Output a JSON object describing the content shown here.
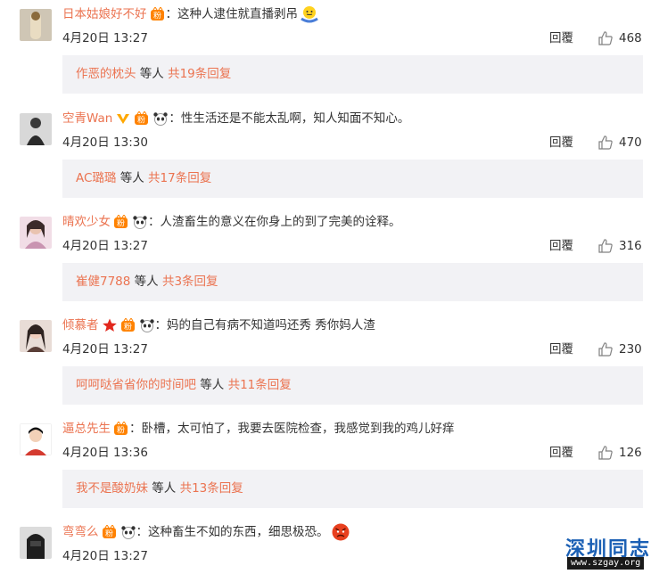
{
  "comments": [
    {
      "user": "日本姑娘好不好",
      "text": "：这种人逮住就直播剥吊",
      "time": "4月20日 13:27",
      "reply": "回覆",
      "likes": "468",
      "replies": {
        "name": "作恶的枕头",
        "mid": " 等人 ",
        "count": "共19条回复"
      }
    },
    {
      "user": "空青Wan",
      "text": "：性生活还是不能太乱啊，知人知面不知心。",
      "time": "4月20日 13:30",
      "reply": "回覆",
      "likes": "470",
      "replies": {
        "name": "AC璐璐",
        "mid": " 等人 ",
        "count": "共17条回复"
      }
    },
    {
      "user": "晴欢少女",
      "text": "：人渣畜生的意义在你身上的到了完美的诠释。",
      "time": "4月20日 13:27",
      "reply": "回覆",
      "likes": "316",
      "replies": {
        "name": "崔健7788",
        "mid": " 等人 ",
        "count": "共3条回复"
      }
    },
    {
      "user": "倾慕者",
      "text": "：妈的自己有病不知道吗还秀 秀你妈人渣",
      "time": "4月20日 13:27",
      "reply": "回覆",
      "likes": "230",
      "replies": {
        "name": "呵呵哒省省你的时间吧",
        "mid": " 等人 ",
        "count": "共11条回复"
      }
    },
    {
      "user": "逼总先生",
      "text": "：卧槽，太可怕了，我要去医院检查，我感觉到我的鸡儿好痒",
      "time": "4月20日 13:36",
      "reply": "回覆",
      "likes": "126",
      "replies": {
        "name": "我不是酸奶妹",
        "mid": " 等人 ",
        "count": "共13条回复"
      }
    },
    {
      "user": "弯弯么",
      "text": "：这种畜生不如的东西，细思极恐。",
      "time": "4月20日 13:27",
      "reply": "",
      "likes": ""
    }
  ],
  "watermark": {
    "title": "深圳同志",
    "url": "www.szgay.org"
  },
  "colors": {
    "username": "#eb7350",
    "reply_bg": "#f2f2f5"
  }
}
